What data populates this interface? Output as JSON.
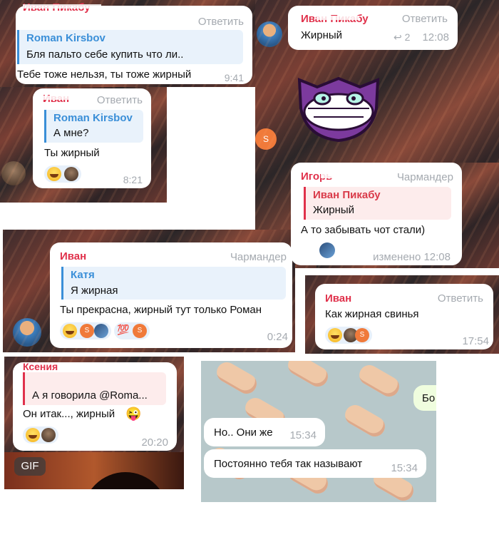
{
  "panel1": {
    "name": "Иван Пикабу",
    "reply": "Ответить",
    "quote_name": "Roman Kirsbov",
    "quote_text": "Бля пальто себе купить что ли..",
    "text": "Тебе тоже нельзя, ты тоже жирный",
    "time": "9:41"
  },
  "panel2": {
    "name": "Иван Пикабу",
    "reply": "Ответить",
    "text": "Жирный",
    "reply_count": "↩ 2",
    "time": "12:08",
    "sticker": "cheshire-cat-sticker",
    "avatar_letter": "S"
  },
  "panel3": {
    "name": "Иван",
    "reply": "Ответить",
    "quote_name": "Roman Kirsbov",
    "quote_text": "А мне?",
    "text": "Ты жирный",
    "time": "8:21"
  },
  "panel4": {
    "name": "Игорь",
    "title": "Чармандер",
    "quote_name": "Иван Пикабу",
    "quote_text": "Жирный",
    "text": "А то забывать чот стали)",
    "time": "изменено 12:08"
  },
  "panel5": {
    "name": "Иван",
    "title": "Чармандер",
    "quote_name": "Катя",
    "quote_text": "Я жирная",
    "text": "Ты прекрасна, жирный тут только Роман",
    "time": "0:24",
    "react_letter": "S",
    "react_hundred": "💯"
  },
  "panel6": {
    "name": "Иван",
    "reply": "Ответить",
    "text": "Как жирная свинья",
    "time": "17:54",
    "react_letter": "S"
  },
  "panel7": {
    "name": "Ксения",
    "quote_text": "А я говорила @Roma...",
    "text": "Он итак..., жирный",
    "emoji": "😜",
    "time": "20:20",
    "gif": "GIF"
  },
  "panel8": {
    "msg1_text": "Но.. Они же",
    "msg1_time": "15:34",
    "msg2_text": "Постоянно тебя так называют",
    "msg2_time": "15:34",
    "partial": "Бо"
  }
}
